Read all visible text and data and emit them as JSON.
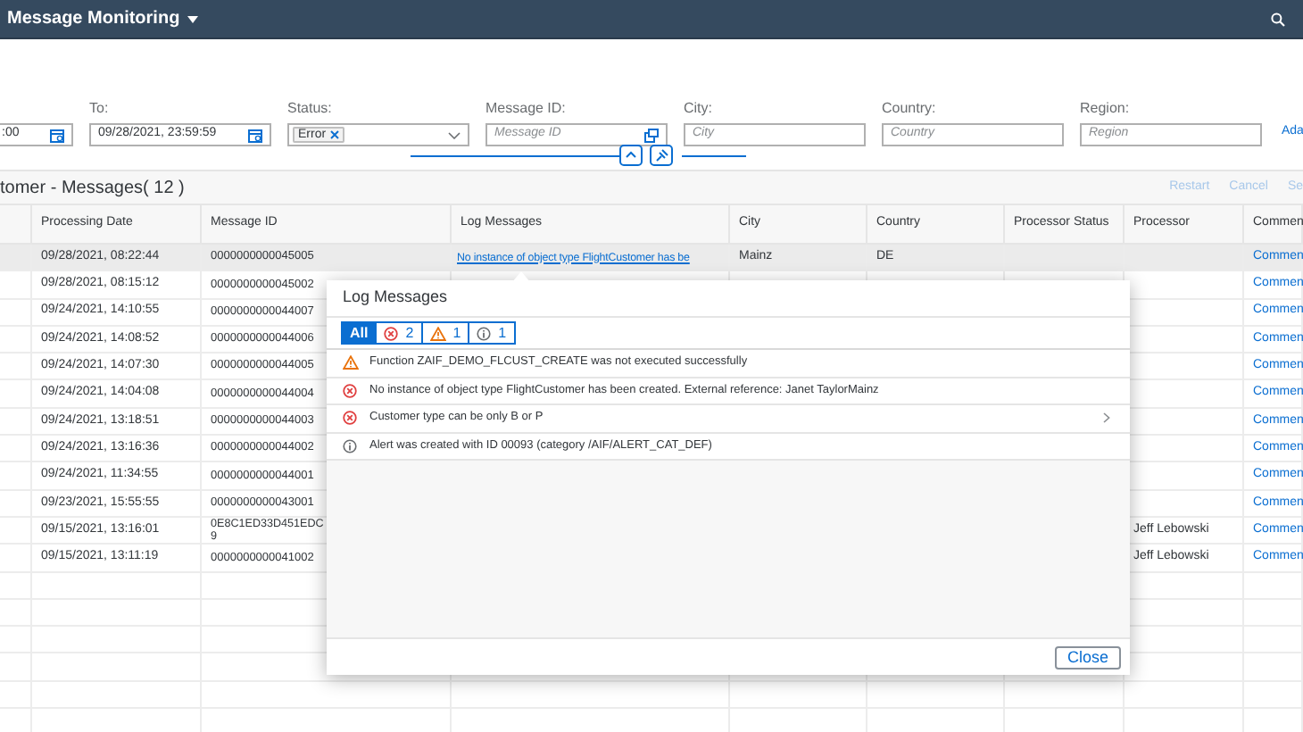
{
  "shell": {
    "title": "Message Monitoring"
  },
  "filters": [
    {
      "kind": "date",
      "value": ":00"
    },
    {
      "kind": "date",
      "label": "To:",
      "value": "09/28/2021, 23:59:59"
    },
    {
      "kind": "multi",
      "label": "Status:",
      "tokens": [
        "Error"
      ]
    },
    {
      "kind": "valuehelp",
      "label": "Message ID:",
      "placeholder": "Message ID"
    },
    {
      "kind": "text",
      "label": "City:",
      "placeholder": "City"
    },
    {
      "kind": "text",
      "label": "Country:",
      "placeholder": "Country"
    },
    {
      "kind": "text",
      "label": "Region:",
      "placeholder": "Region"
    }
  ],
  "adapt_link": "Ada",
  "table": {
    "title": "tomer - Messages( 12 )",
    "actions": [
      {
        "label": "Restart",
        "disabled": true
      },
      {
        "label": "Cancel",
        "disabled": true
      },
      {
        "label": "Se",
        "disabled": true
      }
    ],
    "columns": [
      "Processing Date",
      "Message ID",
      "Log Messages",
      "City",
      "Country",
      "Processor Status",
      "Processor",
      "Commen"
    ],
    "rows": [
      {
        "processing_date": "09/28/2021, 08:22:44",
        "message_id": "0000000000045005",
        "log_message": "No instance of object type FlightCustomer has be",
        "city": "Mainz",
        "country": "DE",
        "comment": "Commen",
        "highlighted": true
      },
      {
        "processing_date": "09/28/2021, 08:15:12",
        "message_id": "0000000000045002",
        "comment": "Commen",
        "highlighted": false
      },
      {
        "processing_date": "09/24/2021, 14:10:55",
        "message_id": "0000000000044007",
        "comment": "Commen",
        "highlighted": false
      },
      {
        "processing_date": "09/24/2021, 14:08:52",
        "message_id": "0000000000044006",
        "comment": "Commen",
        "highlighted": false
      },
      {
        "processing_date": "09/24/2021, 14:07:30",
        "message_id": "0000000000044005",
        "comment": "Commen",
        "highlighted": false
      },
      {
        "processing_date": "09/24/2021, 14:04:08",
        "message_id": "0000000000044004",
        "comment": "Commen",
        "highlighted": false
      },
      {
        "processing_date": "09/24/2021, 13:18:51",
        "message_id": "0000000000044003",
        "comment": "Commen",
        "highlighted": false
      },
      {
        "processing_date": "09/24/2021, 13:16:36",
        "message_id": "0000000000044002",
        "comment": "Commen",
        "highlighted": false
      },
      {
        "processing_date": "09/24/2021, 11:34:55",
        "message_id": "0000000000044001",
        "comment": "Commen",
        "highlighted": false
      },
      {
        "processing_date": "09/23/2021, 15:55:55",
        "message_id": "0000000000043001",
        "comment": "Commen",
        "highlighted": false
      },
      {
        "processing_date": "09/15/2021, 13:16:01",
        "message_id": "0E8C1ED33D451EDC\n9",
        "processor": "Jeff Lebowski",
        "comment": "Commen",
        "highlighted": false
      },
      {
        "processing_date": "09/15/2021, 13:11:19",
        "message_id": "0000000000041002",
        "processor": "Jeff Lebowski",
        "comment": "Commen",
        "highlighted": false
      }
    ]
  },
  "popover": {
    "title": "Log Messages",
    "filters": [
      {
        "kind": "all",
        "label": "All",
        "selected": true
      },
      {
        "kind": "error",
        "count": "2",
        "selected": false
      },
      {
        "kind": "warning",
        "count": "1",
        "selected": false
      },
      {
        "kind": "info",
        "count": "1",
        "selected": false
      }
    ],
    "messages": [
      {
        "kind": "warning",
        "text": "Function ZAIF_DEMO_FLCUST_CREATE was not executed successfully",
        "navigable": false
      },
      {
        "kind": "error",
        "text": "No instance of object type FlightCustomer has been created. External reference: Janet TaylorMainz",
        "navigable": false
      },
      {
        "kind": "error",
        "text": "Customer type can be only B or P",
        "navigable": true
      },
      {
        "kind": "info",
        "text": "Alert was created with ID 00093 (category /AIF/ALERT_CAT_DEF)",
        "navigable": false
      }
    ],
    "close": "Close"
  }
}
